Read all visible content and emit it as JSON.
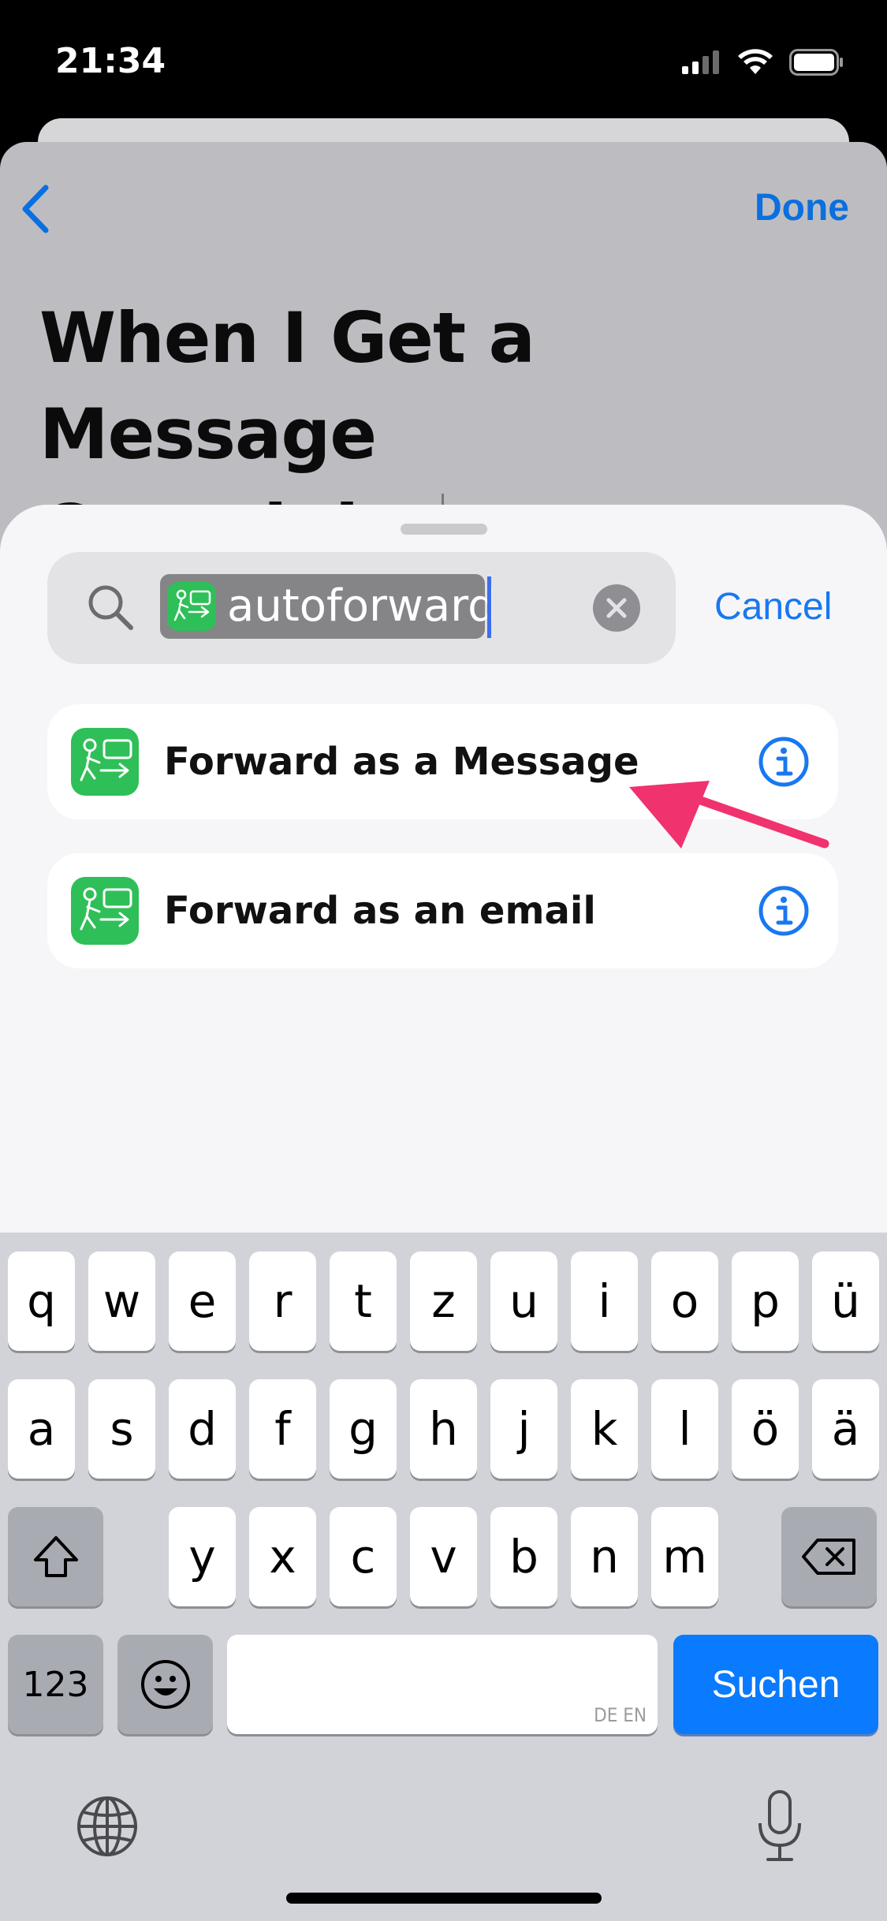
{
  "status_bar": {
    "time": "21:34"
  },
  "nav": {
    "done_label": "Done"
  },
  "automation": {
    "title": "When I Get a Message Containing…"
  },
  "search": {
    "query": "autoforward",
    "cancel_label": "Cancel"
  },
  "results": [
    {
      "label": "Forward as a Message"
    },
    {
      "label": "Forward as an email"
    }
  ],
  "keyboard": {
    "row1": [
      "q",
      "w",
      "e",
      "r",
      "t",
      "z",
      "u",
      "i",
      "o",
      "p",
      "ü"
    ],
    "row2": [
      "a",
      "s",
      "d",
      "f",
      "g",
      "h",
      "j",
      "k",
      "l",
      "ö",
      "ä"
    ],
    "row3": [
      "y",
      "x",
      "c",
      "v",
      "b",
      "n",
      "m"
    ],
    "numbers_label": "123",
    "space_lang_hint": "DE EN",
    "return_label": "Suchen"
  },
  "colors": {
    "accent": "#0a7aff",
    "app_green": "#2fbf58",
    "annotation_arrow": "#f0326e"
  }
}
